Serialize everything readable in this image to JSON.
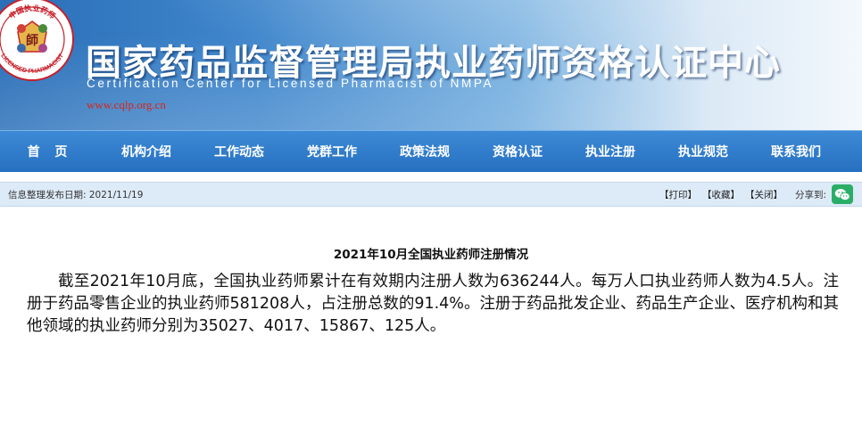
{
  "header": {
    "title": "国家药品监督管理局执业药师资格认证中心",
    "subtitle": "Certification Center for Licensed Pharmacist of NMPA",
    "url": "www.cqlp.org.cn",
    "logo": {
      "top_text": "中国执业药师",
      "bottom_text": "LICENSED PHARMACIST",
      "center_char": "師"
    }
  },
  "nav": {
    "items": [
      {
        "label": "首 页"
      },
      {
        "label": "机构介绍"
      },
      {
        "label": "工作动态"
      },
      {
        "label": "党群工作"
      },
      {
        "label": "政策法规"
      },
      {
        "label": "资格认证"
      },
      {
        "label": "执业注册"
      },
      {
        "label": "执业规范"
      },
      {
        "label": "联系我们"
      }
    ]
  },
  "infobar": {
    "date_text": "信息整理发布日期: 2021/11/19",
    "print_label": "【打印】",
    "favorite_label": "【收藏】",
    "close_label": "【关闭】",
    "share_label": "分享到:",
    "share_icon": "wechat-icon"
  },
  "article": {
    "title": "2021年10月全国执业药师注册情况",
    "body": "截至2021年10月底，全国执业药师累计在有效期内注册人数为636244人。每万人口执业药师人数为4.5人。注册于药品零售企业的执业药师581208人，占注册总数的91.4%。注册于药品批发企业、药品生产企业、医疗机构和其他领域的执业药师分别为35027、4017、15867、125人。"
  },
  "colors": {
    "banner_dark": "#2a6fb8",
    "nav_blue": "#2670c0",
    "infobar_bg": "#ddeaf7",
    "url_red": "#d8261a",
    "wechat_green": "#2aae67"
  }
}
